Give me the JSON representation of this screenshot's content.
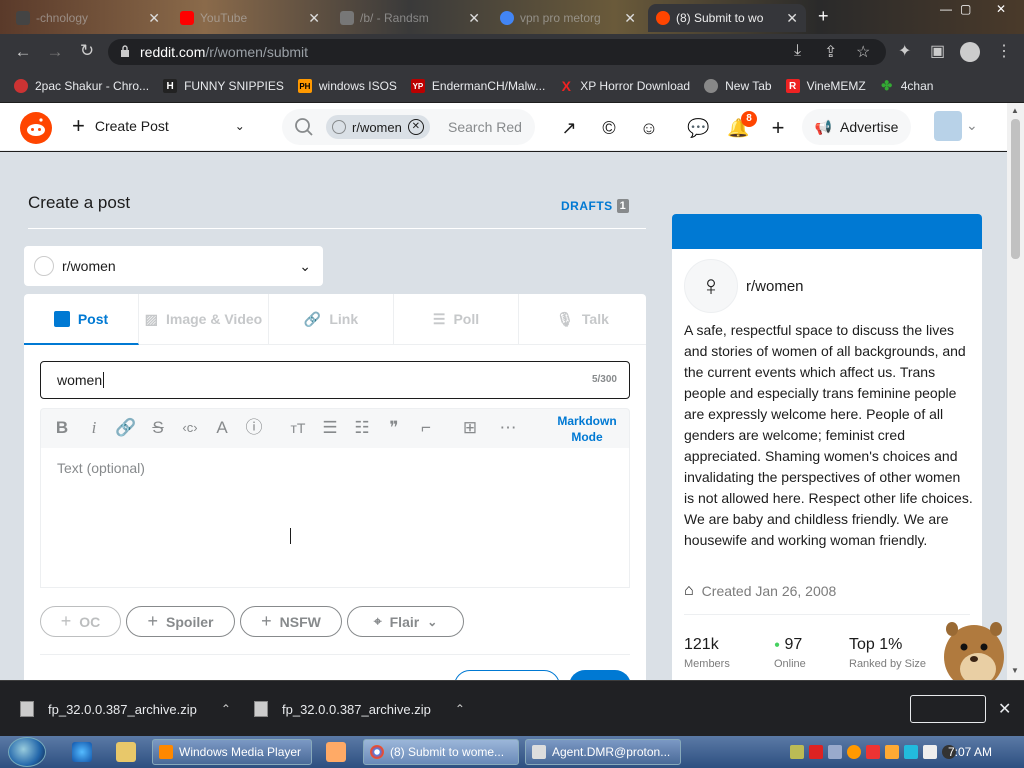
{
  "browser": {
    "tabs": [
      {
        "title": "-chnology",
        "active": false,
        "favicon_color": "#444"
      },
      {
        "title": "YouTube",
        "active": false,
        "favicon_color": "#f00"
      },
      {
        "title": "/b/ - Randsm",
        "active": false,
        "favicon_color": "#777"
      },
      {
        "title": "vpn pro metorg",
        "active": false,
        "favicon_color": "#4285f4"
      },
      {
        "title": "(8) Submit to wo",
        "active": true,
        "favicon_color": "#ff4500"
      }
    ],
    "url_host": "reddit.com",
    "url_path": "/r/women/submit",
    "bookmarks": [
      {
        "label": "2pac Shakur - Chro...",
        "icon": "music-icon",
        "color": "#c33"
      },
      {
        "label": "FUNNY SNIPPIES",
        "icon": "H",
        "color": "#222"
      },
      {
        "label": "windows ISOS",
        "icon": "PH",
        "color": "#f90"
      },
      {
        "label": "EndermanCH/Malw...",
        "icon": "YP",
        "color": "#b00"
      },
      {
        "label": "XP Horror Download",
        "icon": "X",
        "color": "#d00"
      },
      {
        "label": "New Tab",
        "icon": "globe-icon",
        "color": "#888"
      },
      {
        "label": "VineMEMZ",
        "icon": "R",
        "color": "#e22"
      },
      {
        "label": "4chan",
        "icon": "clover-icon",
        "color": "#3a3"
      }
    ]
  },
  "reddit": {
    "header": {
      "create_post": "Create Post",
      "search_chip": "r/women",
      "search_placeholder": "Search Red",
      "notification_count": "8",
      "advertise": "Advertise"
    },
    "page_title": "Create a post",
    "drafts_label": "DRAFTS",
    "drafts_count": "1",
    "community": "r/women",
    "post_tabs": [
      "Post",
      "Image & Video",
      "Link",
      "Poll",
      "Talk"
    ],
    "title_value": "women",
    "title_count": "5/300",
    "markdown_mode": "Markdown Mode",
    "body_placeholder": "Text (optional)",
    "pills": [
      "OC",
      "Spoiler",
      "NSFW",
      "Flair"
    ],
    "sidebar": {
      "name": "r/women",
      "description": "A safe, respectful space to discuss the lives and stories of women of all backgrounds, and the current events which affect us. Trans people and especially trans feminine people are expressly welcome here. People of all genders are welcome; feminist cred appreciated. Shaming women's choices and invalidating the perspectives of other women is not allowed here. Respect other life choices. We are baby and childless friendly. We are housewife and working woman friendly.",
      "created": "Created Jan 26, 2008",
      "members_value": "121k",
      "members_label": "Members",
      "online_value": "97",
      "online_label": "Online",
      "rank_value": "Top 1%",
      "rank_label": "Ranked by Size"
    },
    "accent_color": "#0079d3",
    "brand_color": "#ff4500"
  },
  "downloads": [
    {
      "filename": "fp_32.0.0.387_archive.zip"
    },
    {
      "filename": "fp_32.0.0.387_archive.zip"
    }
  ],
  "taskbar": {
    "tasks": [
      {
        "label": "Windows Media Player",
        "active": false
      },
      {
        "label": "(8) Submit to wome...",
        "active": true
      },
      {
        "label": "Agent.DMR@proton...",
        "active": false
      }
    ],
    "clock": "7:07 AM"
  }
}
